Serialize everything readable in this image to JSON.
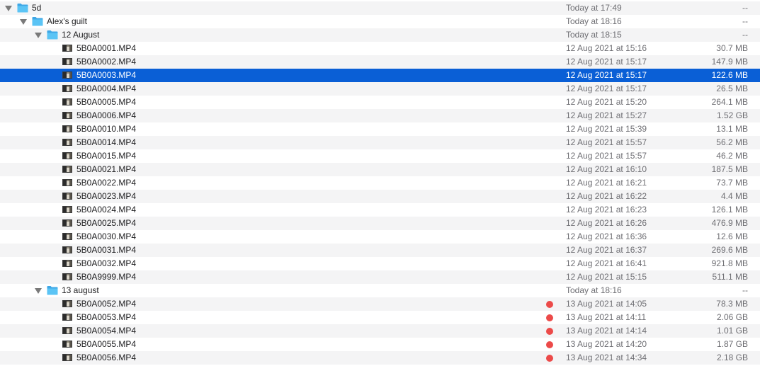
{
  "colors": {
    "selection": "#0a5fd6",
    "folder": "#5bc4f5",
    "tag_red": "#ec4a49",
    "alt_row": "#f4f4f5"
  },
  "rows": [
    {
      "kind": "folder",
      "level": 0,
      "expanded": true,
      "name": "5d",
      "date": "Today at 17:49",
      "size": "--",
      "tag": null,
      "selected": false,
      "icon": "folder-icon"
    },
    {
      "kind": "folder",
      "level": 1,
      "expanded": true,
      "name": "Alex's guilt",
      "date": "Today at 18:16",
      "size": "--",
      "tag": null,
      "selected": false,
      "icon": "folder-icon"
    },
    {
      "kind": "folder",
      "level": 2,
      "expanded": true,
      "name": "12 August",
      "date": "Today at 18:15",
      "size": "--",
      "tag": null,
      "selected": false,
      "icon": "folder-icon"
    },
    {
      "kind": "file",
      "level": 3,
      "name": "5B0A0001.MP4",
      "date": "12 Aug 2021 at 15:16",
      "size": "30.7 MB",
      "tag": null,
      "selected": false,
      "icon": "video-thumbnail-icon"
    },
    {
      "kind": "file",
      "level": 3,
      "name": "5B0A0002.MP4",
      "date": "12 Aug 2021 at 15:17",
      "size": "147.9 MB",
      "tag": null,
      "selected": false,
      "icon": "video-thumbnail-icon"
    },
    {
      "kind": "file",
      "level": 3,
      "name": "5B0A0003.MP4",
      "date": "12 Aug 2021 at 15:17",
      "size": "122.6 MB",
      "tag": null,
      "selected": true,
      "icon": "video-thumbnail-icon"
    },
    {
      "kind": "file",
      "level": 3,
      "name": "5B0A0004.MP4",
      "date": "12 Aug 2021 at 15:17",
      "size": "26.5 MB",
      "tag": null,
      "selected": false,
      "icon": "video-thumbnail-icon"
    },
    {
      "kind": "file",
      "level": 3,
      "name": "5B0A0005.MP4",
      "date": "12 Aug 2021 at 15:20",
      "size": "264.1 MB",
      "tag": null,
      "selected": false,
      "icon": "video-thumbnail-icon"
    },
    {
      "kind": "file",
      "level": 3,
      "name": "5B0A0006.MP4",
      "date": "12 Aug 2021 at 15:27",
      "size": "1.52 GB",
      "tag": null,
      "selected": false,
      "icon": "video-thumbnail-icon"
    },
    {
      "kind": "file",
      "level": 3,
      "name": "5B0A0010.MP4",
      "date": "12 Aug 2021 at 15:39",
      "size": "13.1 MB",
      "tag": null,
      "selected": false,
      "icon": "video-thumbnail-icon"
    },
    {
      "kind": "file",
      "level": 3,
      "name": "5B0A0014.MP4",
      "date": "12 Aug 2021 at 15:57",
      "size": "56.2 MB",
      "tag": null,
      "selected": false,
      "icon": "video-thumbnail-icon"
    },
    {
      "kind": "file",
      "level": 3,
      "name": "5B0A0015.MP4",
      "date": "12 Aug 2021 at 15:57",
      "size": "46.2 MB",
      "tag": null,
      "selected": false,
      "icon": "video-thumbnail-icon"
    },
    {
      "kind": "file",
      "level": 3,
      "name": "5B0A0021.MP4",
      "date": "12 Aug 2021 at 16:10",
      "size": "187.5 MB",
      "tag": null,
      "selected": false,
      "icon": "video-thumbnail-icon"
    },
    {
      "kind": "file",
      "level": 3,
      "name": "5B0A0022.MP4",
      "date": "12 Aug 2021 at 16:21",
      "size": "73.7 MB",
      "tag": null,
      "selected": false,
      "icon": "video-thumbnail-icon"
    },
    {
      "kind": "file",
      "level": 3,
      "name": "5B0A0023.MP4",
      "date": "12 Aug 2021 at 16:22",
      "size": "4.4 MB",
      "tag": null,
      "selected": false,
      "icon": "video-thumbnail-icon"
    },
    {
      "kind": "file",
      "level": 3,
      "name": "5B0A0024.MP4",
      "date": "12 Aug 2021 at 16:23",
      "size": "126.1 MB",
      "tag": null,
      "selected": false,
      "icon": "video-thumbnail-icon"
    },
    {
      "kind": "file",
      "level": 3,
      "name": "5B0A0025.MP4",
      "date": "12 Aug 2021 at 16:26",
      "size": "476.9 MB",
      "tag": null,
      "selected": false,
      "icon": "video-thumbnail-icon"
    },
    {
      "kind": "file",
      "level": 3,
      "name": "5B0A0030.MP4",
      "date": "12 Aug 2021 at 16:36",
      "size": "12.6 MB",
      "tag": null,
      "selected": false,
      "icon": "video-thumbnail-icon"
    },
    {
      "kind": "file",
      "level": 3,
      "name": "5B0A0031.MP4",
      "date": "12 Aug 2021 at 16:37",
      "size": "269.6 MB",
      "tag": null,
      "selected": false,
      "icon": "video-thumbnail-icon"
    },
    {
      "kind": "file",
      "level": 3,
      "name": "5B0A0032.MP4",
      "date": "12 Aug 2021 at 16:41",
      "size": "921.8 MB",
      "tag": null,
      "selected": false,
      "icon": "video-thumbnail-icon"
    },
    {
      "kind": "file",
      "level": 3,
      "name": "5B0A9999.MP4",
      "date": "12 Aug 2021 at 15:15",
      "size": "511.1 MB",
      "tag": null,
      "selected": false,
      "icon": "video-thumbnail-icon"
    },
    {
      "kind": "folder",
      "level": 2,
      "expanded": true,
      "name": "13 august",
      "date": "Today at 18:16",
      "size": "--",
      "tag": null,
      "selected": false,
      "icon": "folder-icon"
    },
    {
      "kind": "file",
      "level": 3,
      "name": "5B0A0052.MP4",
      "date": "13 Aug 2021 at 14:05",
      "size": "78.3 MB",
      "tag": "red",
      "selected": false,
      "icon": "video-thumbnail-icon"
    },
    {
      "kind": "file",
      "level": 3,
      "name": "5B0A0053.MP4",
      "date": "13 Aug 2021 at 14:11",
      "size": "2.06 GB",
      "tag": "red",
      "selected": false,
      "icon": "video-thumbnail-icon"
    },
    {
      "kind": "file",
      "level": 3,
      "name": "5B0A0054.MP4",
      "date": "13 Aug 2021 at 14:14",
      "size": "1.01 GB",
      "tag": "red",
      "selected": false,
      "icon": "video-thumbnail-icon"
    },
    {
      "kind": "file",
      "level": 3,
      "name": "5B0A0055.MP4",
      "date": "13 Aug 2021 at 14:20",
      "size": "1.87 GB",
      "tag": "red",
      "selected": false,
      "icon": "video-thumbnail-icon"
    },
    {
      "kind": "file",
      "level": 3,
      "name": "5B0A0056.MP4",
      "date": "13 Aug 2021 at 14:34",
      "size": "2.18 GB",
      "tag": "red",
      "selected": false,
      "icon": "video-thumbnail-icon"
    }
  ]
}
